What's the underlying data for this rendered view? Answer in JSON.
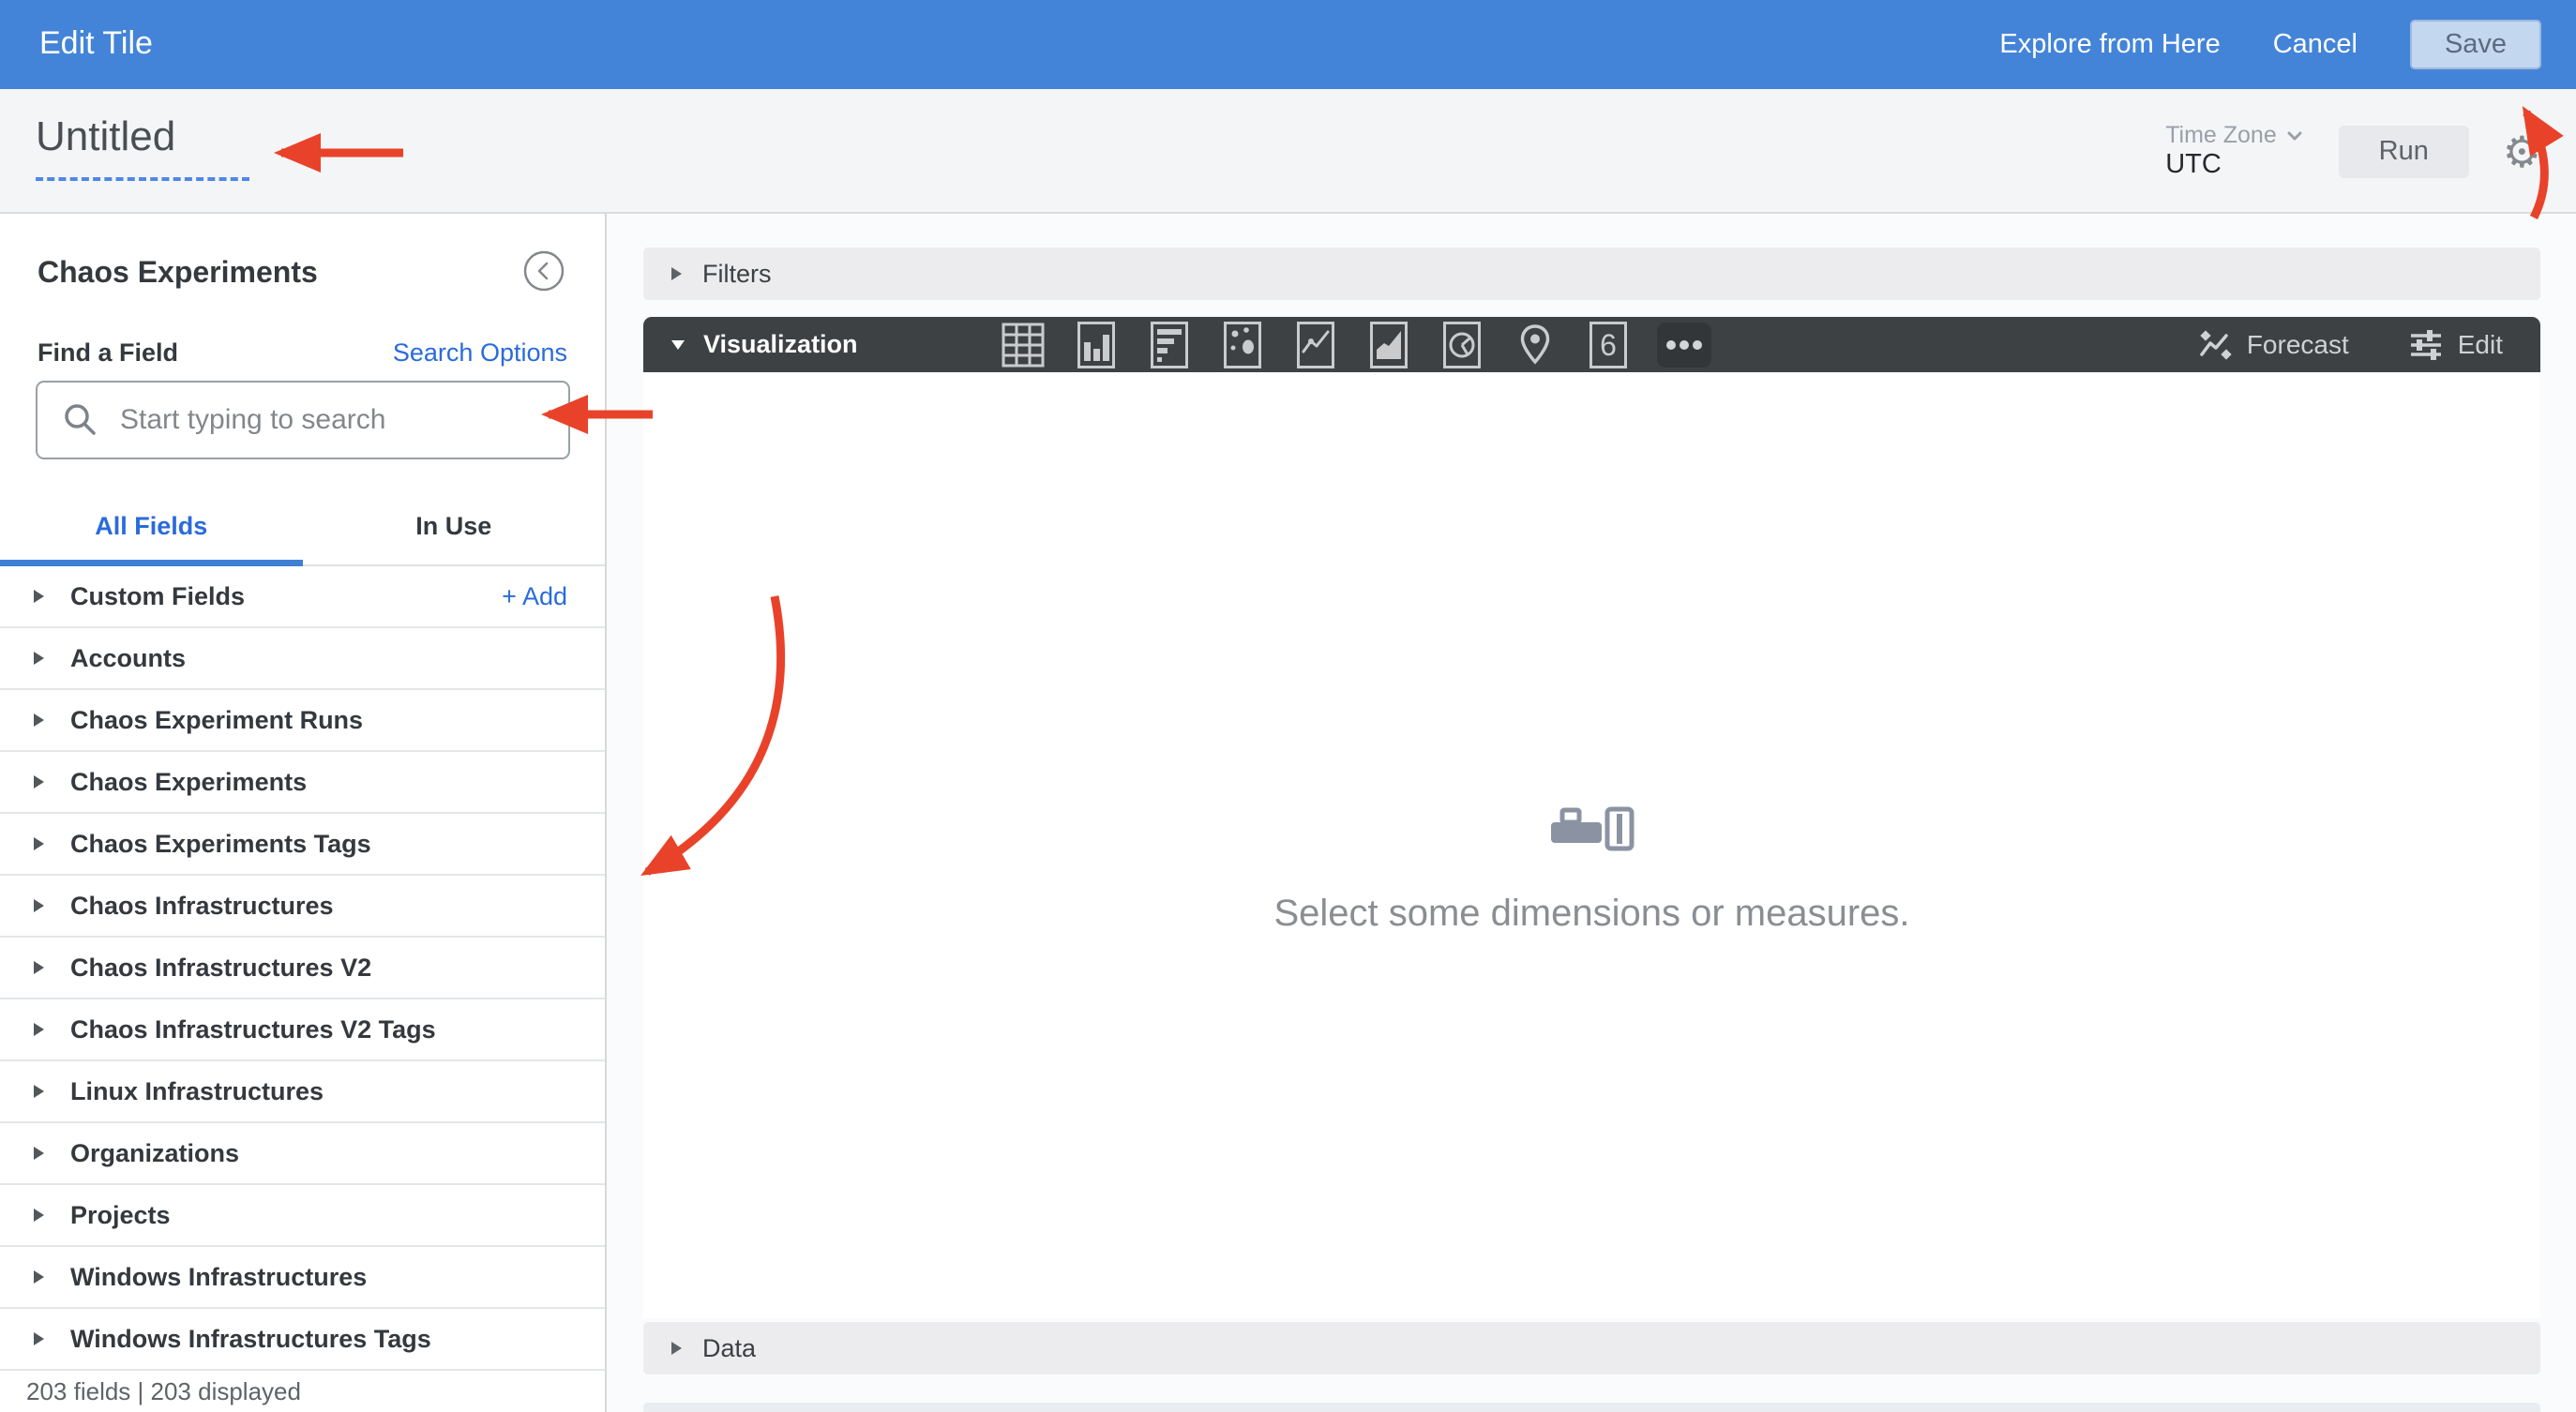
{
  "topbar": {
    "title": "Edit Tile",
    "explore_from_here": "Explore from Here",
    "cancel": "Cancel",
    "save": "Save"
  },
  "titlebar": {
    "tile_title": "Untitled",
    "timezone_label": "Time Zone",
    "timezone_value": "UTC",
    "run": "Run"
  },
  "sidebar": {
    "model_name": "Chaos Experiments",
    "find_label": "Find a Field",
    "search_options": "Search Options",
    "search_placeholder": "Start typing to search",
    "tabs": [
      {
        "label": "All Fields",
        "active": true
      },
      {
        "label": "In Use",
        "active": false
      }
    ],
    "custom_fields": {
      "label": "Custom Fields",
      "add_label": "+ Add"
    },
    "fields": [
      "Accounts",
      "Chaos Experiment Runs",
      "Chaos Experiments",
      "Chaos Experiments Tags",
      "Chaos Infrastructures",
      "Chaos Infrastructures V2",
      "Chaos Infrastructures V2 Tags",
      "Linux Infrastructures",
      "Organizations",
      "Projects",
      "Windows Infrastructures",
      "Windows Infrastructures Tags"
    ],
    "footer": "203 fields | 203 displayed"
  },
  "main": {
    "filters_label": "Filters",
    "data_label": "Data",
    "visualization": {
      "label": "Visualization",
      "icons": [
        "table",
        "column-chart",
        "bar-chart",
        "scatter",
        "line-chart",
        "area-chart",
        "pie-chart",
        "map-pin",
        "single-value",
        "more"
      ],
      "forecast": "Forecast",
      "edit": "Edit"
    },
    "empty_state": {
      "message": "Select some dimensions or measures.",
      "icon": "flashlight-icon"
    }
  },
  "colors": {
    "topbar_blue": "#4384d8",
    "link_blue": "#2a6bdb",
    "annotation_red": "#e8432a",
    "viz_bar_dark": "#3e4144",
    "save_button_bg": "#c3d7ef"
  }
}
